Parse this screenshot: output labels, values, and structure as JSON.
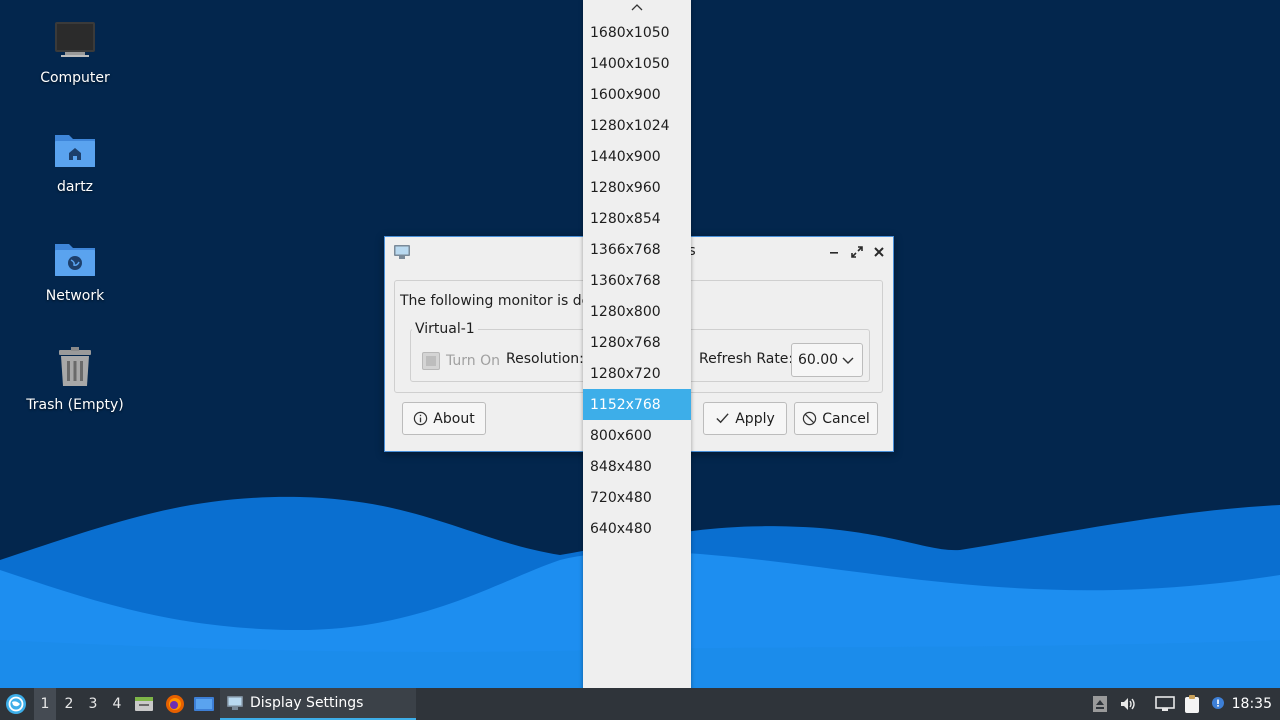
{
  "desktop": {
    "icons": [
      {
        "label": "Computer",
        "icon": "computer-icon"
      },
      {
        "label": "dartz",
        "icon": "home-folder-icon"
      },
      {
        "label": "Network",
        "icon": "network-folder-icon"
      },
      {
        "label": "Trash (Empty)",
        "icon": "trash-icon"
      }
    ]
  },
  "dialog": {
    "title": "Display Settings",
    "detected_text": "The following monitor is detected:",
    "monitor_name": "Virtual-1",
    "turn_on_label": "Turn On",
    "resolution_label": "Resolution:",
    "refresh_rate_label": "Refresh Rate:",
    "refresh_rate_value": "60.00",
    "buttons": {
      "about": "About",
      "apply": "Apply",
      "cancel": "Cancel"
    }
  },
  "resolution_dropdown": {
    "options": [
      "1680x1050",
      "1400x1050",
      "1600x900",
      "1280x1024",
      "1440x900",
      "1280x960",
      "1280x854",
      "1366x768",
      "1360x768",
      "1280x800",
      "1280x768",
      "1280x720",
      "1152x768",
      "800x600",
      "848x480",
      "720x480",
      "640x480"
    ],
    "selected": "1152x768"
  },
  "taskbar": {
    "workspaces": [
      "1",
      "2",
      "3",
      "4"
    ],
    "active_workspace": "1",
    "task_title": "Display Settings",
    "clock": "18:35"
  },
  "colors": {
    "accent": "#3daee9",
    "desktop_bg": "#03264d",
    "taskbar_bg": "#2f343a"
  }
}
